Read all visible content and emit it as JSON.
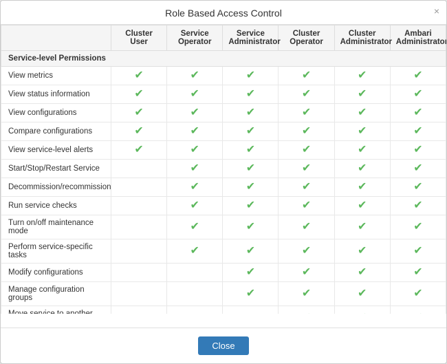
{
  "modal": {
    "title": "Role Based Access Control",
    "close_x": "×",
    "close_button_label": "Close"
  },
  "table": {
    "columns": [
      "",
      "Cluster User",
      "Service Operator",
      "Service Administrator",
      "Cluster Operator",
      "Cluster Administrator",
      "Ambari Administrator"
    ],
    "section_headers": [
      {
        "label": "Service-level Permissions",
        "colspan": 7
      }
    ],
    "rows": [
      {
        "label": "View metrics",
        "checks": [
          true,
          true,
          true,
          true,
          true,
          true
        ]
      },
      {
        "label": "View status information",
        "checks": [
          true,
          true,
          true,
          true,
          true,
          true
        ]
      },
      {
        "label": "View configurations",
        "checks": [
          true,
          true,
          true,
          true,
          true,
          true
        ]
      },
      {
        "label": "Compare configurations",
        "checks": [
          true,
          true,
          true,
          true,
          true,
          true
        ]
      },
      {
        "label": "View service-level alerts",
        "checks": [
          true,
          true,
          true,
          true,
          true,
          true
        ]
      },
      {
        "label": "Start/Stop/Restart Service",
        "checks": [
          false,
          true,
          true,
          true,
          true,
          true
        ]
      },
      {
        "label": "Decommission/recommission",
        "checks": [
          false,
          true,
          true,
          true,
          true,
          true
        ]
      },
      {
        "label": "Run service checks",
        "checks": [
          false,
          true,
          true,
          true,
          true,
          true
        ]
      },
      {
        "label": "Turn on/off maintenance mode",
        "checks": [
          false,
          true,
          true,
          true,
          true,
          true
        ]
      },
      {
        "label": "Perform service-specific tasks",
        "checks": [
          false,
          true,
          true,
          true,
          true,
          true
        ]
      },
      {
        "label": "Modify configurations",
        "checks": [
          false,
          false,
          true,
          true,
          true,
          true
        ]
      },
      {
        "label": "Manage configuration groups",
        "checks": [
          false,
          false,
          true,
          true,
          true,
          true
        ]
      },
      {
        "label": "Move service to another host",
        "checks": [
          false,
          false,
          false,
          true,
          true,
          true
        ]
      }
    ],
    "checkmark_symbol": "✔"
  }
}
